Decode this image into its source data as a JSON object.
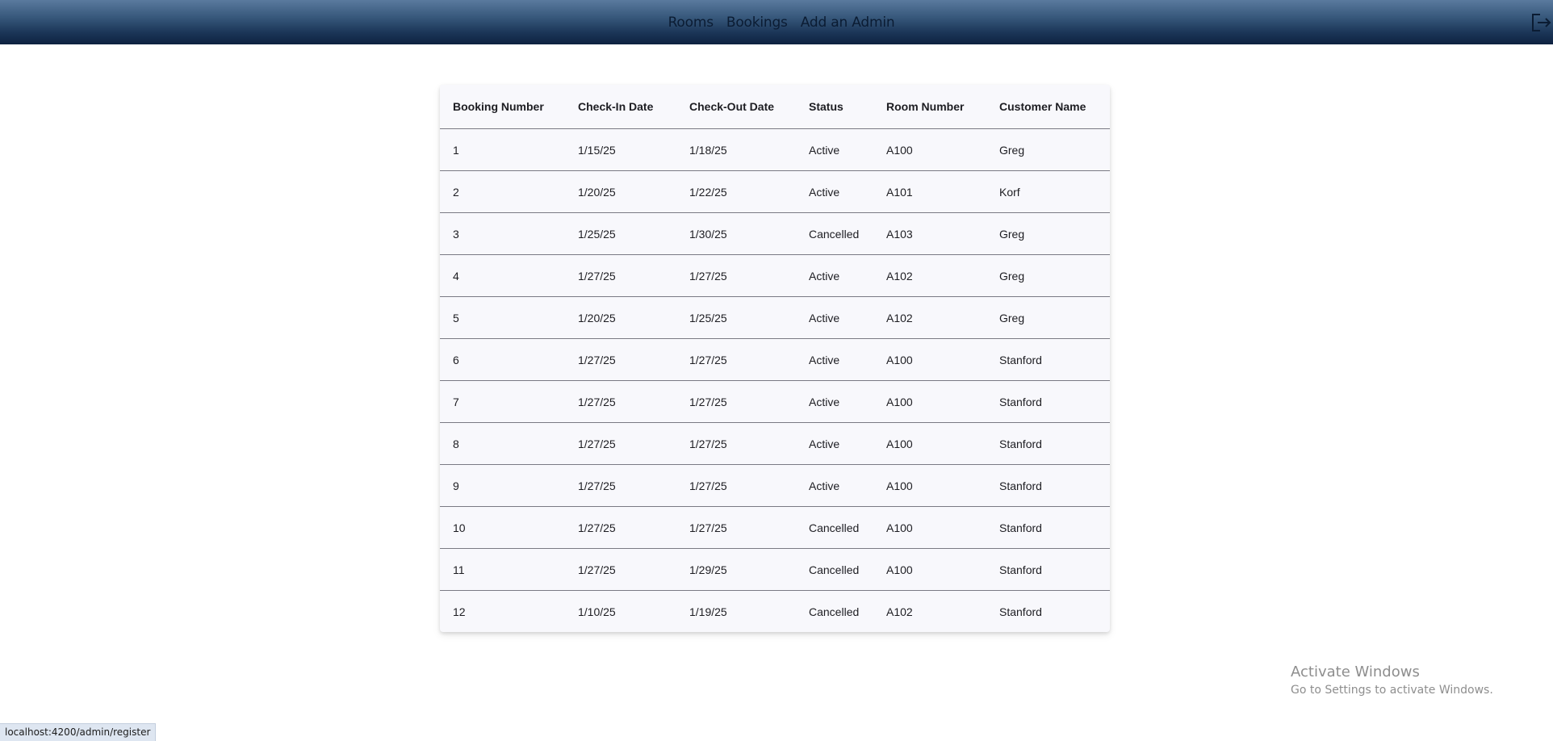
{
  "nav": {
    "items": [
      "Rooms",
      "Bookings",
      "Add an Admin"
    ],
    "logout_icon": "logout-icon"
  },
  "table": {
    "headers": [
      "Booking Number",
      "Check-In Date",
      "Check-Out Date",
      "Status",
      "Room Number",
      "Customer Name"
    ],
    "rows": [
      [
        "1",
        "1/15/25",
        "1/18/25",
        "Active",
        "A100",
        "Greg"
      ],
      [
        "2",
        "1/20/25",
        "1/22/25",
        "Active",
        "A101",
        "Korf"
      ],
      [
        "3",
        "1/25/25",
        "1/30/25",
        "Cancelled",
        "A103",
        "Greg"
      ],
      [
        "4",
        "1/27/25",
        "1/27/25",
        "Active",
        "A102",
        "Greg"
      ],
      [
        "5",
        "1/20/25",
        "1/25/25",
        "Active",
        "A102",
        "Greg"
      ],
      [
        "6",
        "1/27/25",
        "1/27/25",
        "Active",
        "A100",
        "Stanford"
      ],
      [
        "7",
        "1/27/25",
        "1/27/25",
        "Active",
        "A100",
        "Stanford"
      ],
      [
        "8",
        "1/27/25",
        "1/27/25",
        "Active",
        "A100",
        "Stanford"
      ],
      [
        "9",
        "1/27/25",
        "1/27/25",
        "Active",
        "A100",
        "Stanford"
      ],
      [
        "10",
        "1/27/25",
        "1/27/25",
        "Cancelled",
        "A100",
        "Stanford"
      ],
      [
        "11",
        "1/27/25",
        "1/29/25",
        "Cancelled",
        "A100",
        "Stanford"
      ],
      [
        "12",
        "1/10/25",
        "1/19/25",
        "Cancelled",
        "A102",
        "Stanford"
      ]
    ]
  },
  "watermark": {
    "title": "Activate Windows",
    "subtitle": "Go to Settings to activate Windows."
  },
  "statusbar": {
    "url": "localhost:4200/admin/register"
  },
  "colors": {
    "header_top": "#5a7a9e",
    "header_bottom": "#0e2240",
    "table_bg": "#f8f8fc"
  }
}
